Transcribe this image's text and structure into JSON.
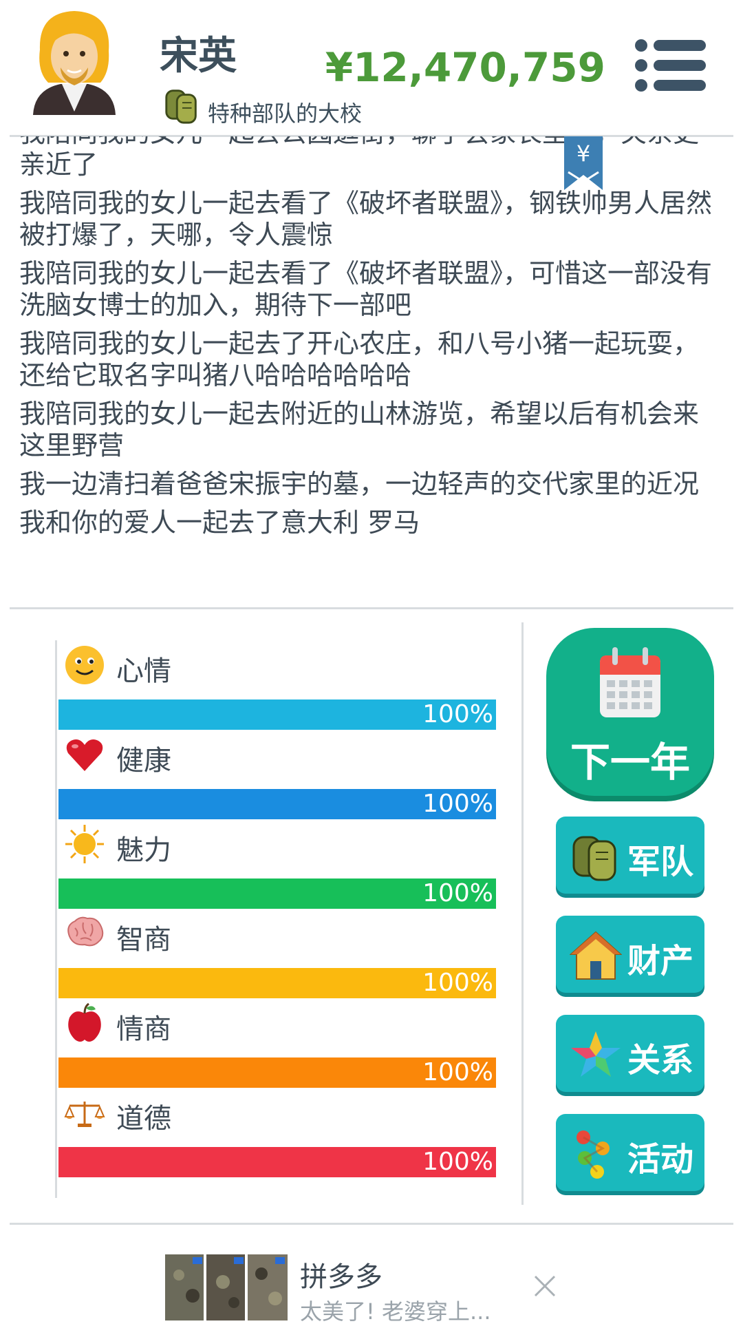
{
  "header": {
    "player_name": "宋英",
    "rank_label": "特种部队的大校",
    "money": "¥12,470,759",
    "avatar_icon": "blonde-bearded-man-avatar",
    "rank_icon": "dog-tags-icon",
    "menu_icon": "hamburger-menu-icon"
  },
  "log": {
    "bookmark_icon": "yen-bookmark-icon",
    "bookmark_symbol": "¥",
    "entries": [
      "我陪同我的女儿一起去公园逛街，聊了会家长里短，关系更亲近了",
      "我陪同我的女儿一起去看了《破坏者联盟》，钢铁帅男人居然被打爆了，天哪，令人震惊",
      "我陪同我的女儿一起去看了《破坏者联盟》，可惜这一部没有洗脑女博士的加入，期待下一部吧",
      "我陪同我的女儿一起去了开心农庄，和八号小猪一起玩耍，还给它取名字叫猪八哈哈哈哈哈哈",
      "我陪同我的女儿一起去附近的山林游览，希望以后有机会来这里野营",
      "我一边清扫着爸爸宋振宇的墓，一边轻声的交代家里的近况",
      "我和你的爱人一起去了意大利 罗马"
    ]
  },
  "stats": [
    {
      "label": "心情",
      "value": 100,
      "pct_label": "100%",
      "color": "#1db4df",
      "icon": "smiley-face-icon"
    },
    {
      "label": "健康",
      "value": 100,
      "pct_label": "100%",
      "color": "#1a8de0",
      "icon": "red-heart-icon"
    },
    {
      "label": "魅力",
      "value": 100,
      "pct_label": "100%",
      "color": "#17bf59",
      "icon": "sun-icon"
    },
    {
      "label": "智商",
      "value": 100,
      "pct_label": "100%",
      "color": "#fbb90e",
      "icon": "brain-icon"
    },
    {
      "label": "情商",
      "value": 100,
      "pct_label": "100%",
      "color": "#fa8709",
      "icon": "red-apple-icon"
    },
    {
      "label": "道德",
      "value": 100,
      "pct_label": "100%",
      "color": "#ef3447",
      "icon": "balance-scale-icon"
    }
  ],
  "actions": {
    "next_year": {
      "label": "下一年",
      "icon": "calendar-icon",
      "color": "#12b08a"
    },
    "buttons": [
      {
        "label": "军队",
        "icon": "dog-tags-icon"
      },
      {
        "label": "财产",
        "icon": "house-icon"
      },
      {
        "label": "关系",
        "icon": "star-icon"
      },
      {
        "label": "活动",
        "icon": "activity-dots-icon"
      }
    ],
    "button_color": "#1ab9bd"
  },
  "ad": {
    "title": "拼多多",
    "subtitle": "太美了! 老婆穿上...",
    "thumb_icon": "product-thumbnails",
    "close_icon": "close-icon"
  }
}
